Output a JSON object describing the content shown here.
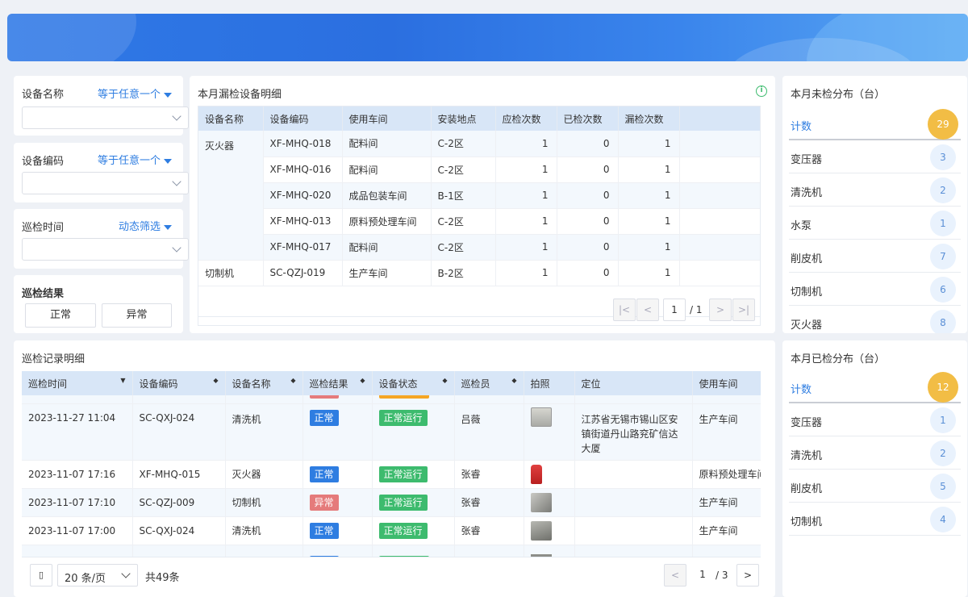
{
  "filters": {
    "device_name": {
      "label": "设备名称",
      "mode": "等于任意一个"
    },
    "device_code": {
      "label": "设备编码",
      "mode": "等于任意一个"
    },
    "inspect_time": {
      "label": "巡检时间",
      "mode": "动态筛选"
    },
    "result": {
      "label": "巡检结果",
      "options": [
        "正常",
        "异常"
      ]
    }
  },
  "missed": {
    "title": "本月漏检设备明细",
    "columns": [
      "设备名称",
      "设备编码",
      "使用车间",
      "安装地点",
      "应检次数",
      "已检次数",
      "漏检次数"
    ],
    "rows": [
      {
        "name": "灭火器",
        "code": "XF-MHQ-018",
        "workshop": "配料间",
        "location": "C-2区",
        "due": "1",
        "done": "0",
        "missed": "1"
      },
      {
        "name": "",
        "code": "XF-MHQ-016",
        "workshop": "配料间",
        "location": "C-2区",
        "due": "1",
        "done": "0",
        "missed": "1"
      },
      {
        "name": "",
        "code": "XF-MHQ-020",
        "workshop": "成品包装车间",
        "location": "B-1区",
        "due": "1",
        "done": "0",
        "missed": "1"
      },
      {
        "name": "",
        "code": "XF-MHQ-013",
        "workshop": "原料预处理车间",
        "location": "C-2区",
        "due": "1",
        "done": "0",
        "missed": "1"
      },
      {
        "name": "",
        "code": "XF-MHQ-017",
        "workshop": "配料间",
        "location": "C-2区",
        "due": "1",
        "done": "0",
        "missed": "1"
      },
      {
        "name": "切制机",
        "code": "SC-QZJ-019",
        "workshop": "生产车间",
        "location": "B-2区",
        "due": "1",
        "done": "0",
        "missed": "1"
      }
    ],
    "pager": {
      "page": "1",
      "total": "/ 1"
    }
  },
  "records": {
    "title": "巡检记录明细",
    "columns": [
      "巡检时间",
      "设备编码",
      "设备名称",
      "巡检结果",
      "设备状态",
      "巡检员",
      "拍照",
      "定位",
      "使用车间"
    ],
    "rows": [
      {
        "time": "2023-11-27 11:04",
        "code": "SC-QXJ-024",
        "name": "清洗机",
        "result": "正常",
        "result_type": "ok",
        "status": "正常运行",
        "inspector": "吕薇",
        "photo": "machine-photo",
        "location": "江苏省无锡市锡山区安镇街道丹山路兖矿信达大厦",
        "workshop": "生产车间"
      },
      {
        "time": "2023-11-07 17:16",
        "code": "XF-MHQ-015",
        "name": "灭火器",
        "result": "正常",
        "result_type": "ok",
        "status": "正常运行",
        "inspector": "张睿",
        "photo": "extinguisher-photo",
        "location": "",
        "workshop": "原料预处理车间"
      },
      {
        "time": "2023-11-07 17:10",
        "code": "SC-QZJ-009",
        "name": "切制机",
        "result": "异常",
        "result_type": "bad",
        "status": "正常运行",
        "inspector": "张睿",
        "photo": "machine-photo",
        "location": "",
        "workshop": "生产车间"
      },
      {
        "time": "2023-11-07 17:00",
        "code": "SC-QXJ-024",
        "name": "清洗机",
        "result": "正常",
        "result_type": "ok",
        "status": "正常运行",
        "inspector": "张睿",
        "photo": "machine-photo",
        "location": "",
        "workshop": "生产车间"
      }
    ],
    "page_size": "20 条/页",
    "total": "共49条",
    "pager": {
      "page": "1",
      "total": "/ 3"
    }
  },
  "unchecked": {
    "title": "本月未检分布（台）",
    "head": {
      "name": "计数",
      "count": "29"
    },
    "items": [
      {
        "name": "变压器",
        "count": "3"
      },
      {
        "name": "清洗机",
        "count": "2"
      },
      {
        "name": "水泵",
        "count": "1"
      },
      {
        "name": "削皮机",
        "count": "7"
      },
      {
        "name": "切制机",
        "count": "6"
      },
      {
        "name": "灭火器",
        "count": "8"
      }
    ]
  },
  "checked": {
    "title": "本月已检分布（台）",
    "head": {
      "name": "计数",
      "count": "12"
    },
    "items": [
      {
        "name": "变压器",
        "count": "1"
      },
      {
        "name": "清洗机",
        "count": "2"
      },
      {
        "name": "削皮机",
        "count": "5"
      },
      {
        "name": "切制机",
        "count": "4"
      }
    ]
  },
  "colors": {
    "accent": "#2e7de1",
    "ok": "#2e7de1",
    "bad": "#e57b7b",
    "run": "#3dbb6e",
    "badge": "#f2bd45"
  }
}
